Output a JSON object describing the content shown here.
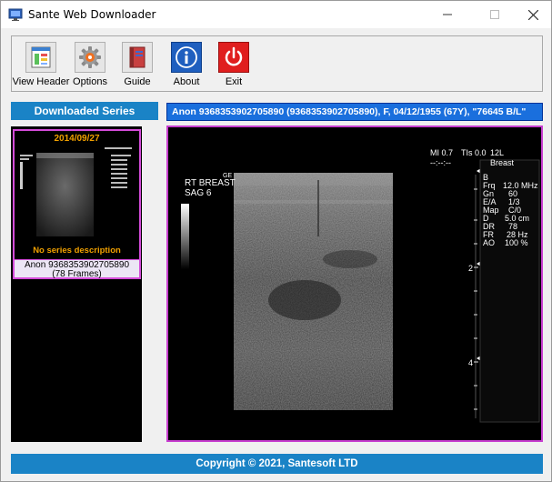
{
  "window": {
    "title": "Sante Web Downloader"
  },
  "toolbar": {
    "buttons": [
      {
        "label": "View Header",
        "icon": "view-header-icon"
      },
      {
        "label": "Options",
        "icon": "gear-icon"
      },
      {
        "label": "Guide",
        "icon": "book-icon"
      },
      {
        "label": "About",
        "icon": "info-icon"
      },
      {
        "label": "Exit",
        "icon": "power-icon"
      }
    ]
  },
  "sidebar": {
    "header": "Downloaded Series",
    "series": [
      {
        "date": "2014/09/27",
        "description": "No series description",
        "patient": "Anon 9368353902705890",
        "frames": "(78 Frames)"
      }
    ]
  },
  "viewer": {
    "patient_bar": "Anon 9368353902705890 (9368353902705890), F, 04/12/1955 (67Y), \"76645 B/L\"",
    "overlay": {
      "mi": "MI 0.7",
      "tis": "TIs 0.0",
      "probe": "12L",
      "time": "--:--:--",
      "preset": "Breast",
      "label_line1": "RT BREAST",
      "label_line2": "SAG 6",
      "ge_mark": "GE",
      "params": [
        {
          "key": "B",
          "value": ""
        },
        {
          "key": "Frq",
          "value": "12.0 MHz"
        },
        {
          "key": "Gn",
          "value": "60"
        },
        {
          "key": "E/A",
          "value": "1/3"
        },
        {
          "key": "Map",
          "value": "C/0"
        },
        {
          "key": "D",
          "value": "5.0 cm"
        },
        {
          "key": "DR",
          "value": "78"
        },
        {
          "key": "FR",
          "value": "28 Hz"
        },
        {
          "key": "AO",
          "value": "100 %"
        }
      ],
      "depth_marks": [
        "2",
        "4"
      ]
    }
  },
  "footer": {
    "copyright": "Copyright © 2021, Santesoft LTD"
  },
  "colors": {
    "accent_blue": "#1a83c6",
    "patient_bar_blue": "#1a6fdd",
    "selection_magenta": "#d44bd9",
    "date_orange": "#f0a000"
  }
}
